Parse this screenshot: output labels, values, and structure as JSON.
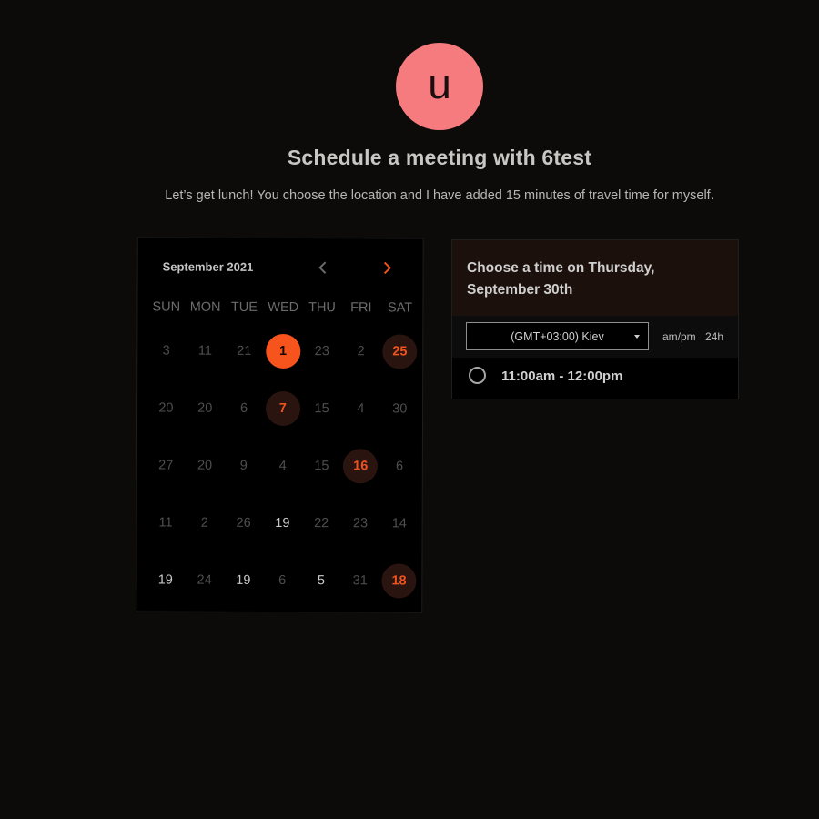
{
  "host": {
    "avatar_letter": "u",
    "title": "Schedule a meeting with 6test",
    "description": "Let’s get lunch! You choose the location and I have added 15 minutes of travel time for myself."
  },
  "calendar": {
    "month_label": "September 2021",
    "weekdays": [
      "SUN",
      "MON",
      "TUE",
      "WED",
      "THU",
      "FRI",
      "SAT"
    ],
    "weeks": [
      [
        {
          "n": "3"
        },
        {
          "n": "11"
        },
        {
          "n": "21"
        },
        {
          "n": "1",
          "state": "selected"
        },
        {
          "n": "23"
        },
        {
          "n": "2"
        },
        {
          "n": "25",
          "state": "available"
        }
      ],
      [
        {
          "n": "20"
        },
        {
          "n": "20"
        },
        {
          "n": "6"
        },
        {
          "n": "7",
          "state": "available"
        },
        {
          "n": "15"
        },
        {
          "n": "4"
        },
        {
          "n": "30"
        }
      ],
      [
        {
          "n": "27"
        },
        {
          "n": "20"
        },
        {
          "n": "9"
        },
        {
          "n": "4"
        },
        {
          "n": "15"
        },
        {
          "n": "16",
          "state": "available"
        },
        {
          "n": "6"
        }
      ],
      [
        {
          "n": "11"
        },
        {
          "n": "2"
        },
        {
          "n": "26"
        },
        {
          "n": "19",
          "state": "active"
        },
        {
          "n": "22"
        },
        {
          "n": "23"
        },
        {
          "n": "14"
        }
      ],
      [
        {
          "n": "19",
          "state": "active"
        },
        {
          "n": "24"
        },
        {
          "n": "19",
          "state": "active"
        },
        {
          "n": "6"
        },
        {
          "n": "5",
          "state": "active"
        },
        {
          "n": "31"
        },
        {
          "n": "18",
          "state": "available"
        }
      ]
    ],
    "prev_icon": "chevron-left-icon",
    "next_icon": "chevron-right-icon",
    "accent_color": "#f7531d"
  },
  "times": {
    "heading": "Choose a time on Thursday, September 30th",
    "timezone_value": "(GMT+03:00) Kiev",
    "format_ampm": "am/pm",
    "format_24h": "24h",
    "slots": [
      "11:00am - 12:00pm"
    ]
  }
}
